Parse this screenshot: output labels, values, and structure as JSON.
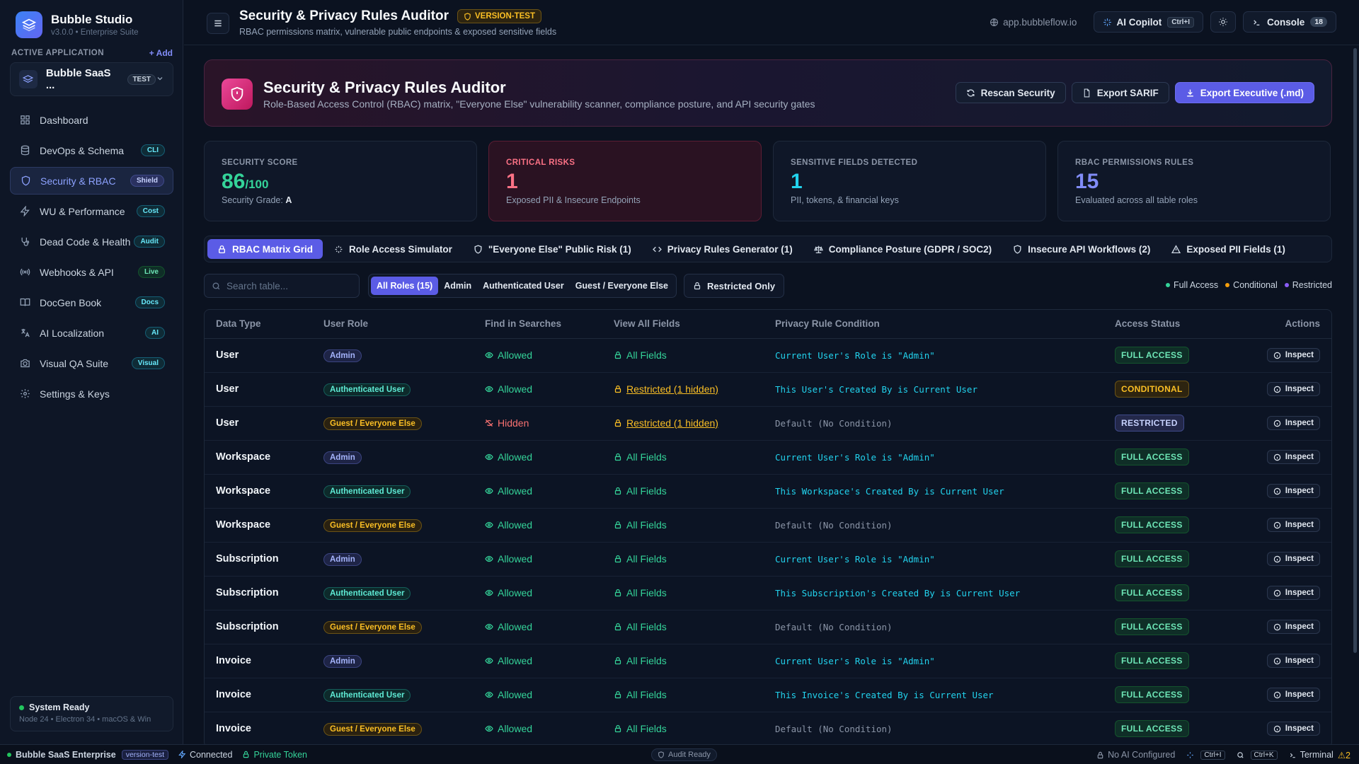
{
  "colors": {
    "accent": "#5b5ce6",
    "full_access": "#34d399",
    "conditional": "#f59e0b",
    "restricted": "#8b5cf6",
    "danger": "#fb7185"
  },
  "brand": {
    "name": "Bubble Studio",
    "version": "v3.0.0 • Enterprise Suite"
  },
  "sidebar": {
    "active_app_label": "ACTIVE APPLICATION",
    "add_label": "+ Add",
    "app_name": "Bubble SaaS ...",
    "app_tag": "TEST",
    "items": [
      {
        "label": "Dashboard",
        "icon": "grid-icon",
        "badge": ""
      },
      {
        "label": "DevOps & Schema",
        "icon": "database-icon",
        "badge": "CLI"
      },
      {
        "label": "Security & RBAC",
        "icon": "shield-icon",
        "badge": "Shield"
      },
      {
        "label": "WU & Performance",
        "icon": "bolt-icon",
        "badge": "Cost"
      },
      {
        "label": "Dead Code & Health",
        "icon": "stethoscope-icon",
        "badge": "Audit"
      },
      {
        "label": "Webhooks & API",
        "icon": "broadcast-icon",
        "badge": "Live"
      },
      {
        "label": "DocGen Book",
        "icon": "book-icon",
        "badge": "Docs"
      },
      {
        "label": "AI Localization",
        "icon": "translate-icon",
        "badge": "AI"
      },
      {
        "label": "Visual QA Suite",
        "icon": "camera-icon",
        "badge": "Visual"
      },
      {
        "label": "Settings & Keys",
        "icon": "gear-icon",
        "badge": ""
      }
    ],
    "status_title": "System Ready",
    "status_sub": "Node 24 • Electron 34 • macOS & Win"
  },
  "header": {
    "title": "Security & Privacy Rules Auditor",
    "version_badge": "VERSION-TEST",
    "subtitle": "RBAC permissions matrix, vulnerable public endpoints & exposed sensitive fields",
    "url": "app.bubbleflow.io",
    "copilot_label": "AI Copilot",
    "copilot_kbd": "Ctrl+I",
    "console_label": "Console",
    "console_count": "18"
  },
  "hero": {
    "title": "Security & Privacy Rules Auditor",
    "subtitle": "Role-Based Access Control (RBAC) matrix, \"Everyone Else\" vulnerability scanner, compliance posture, and API security gates",
    "rescan_label": "Rescan Security",
    "sarif_label": "Export SARIF",
    "exec_label": "Export Executive (.md)"
  },
  "stats": [
    {
      "label": "SECURITY SCORE",
      "value": "86",
      "suffix": "/100",
      "desc_prefix": "Security Grade: ",
      "desc_strong": "A"
    },
    {
      "label": "CRITICAL RISKS",
      "value": "1",
      "desc": "Exposed PII & Insecure Endpoints"
    },
    {
      "label": "SENSITIVE FIELDS DETECTED",
      "value": "1",
      "desc": "PII, tokens, & financial keys"
    },
    {
      "label": "RBAC PERMISSIONS RULES",
      "value": "15",
      "desc": "Evaluated across all table roles"
    }
  ],
  "tabs": [
    "RBAC Matrix Grid",
    "Role Access Simulator",
    "\"Everyone Else\" Public Risk (1)",
    "Privacy Rules Generator (1)",
    "Compliance Posture (GDPR / SOC2)",
    "Insecure API Workflows (2)",
    "Exposed PII Fields (1)"
  ],
  "filters": {
    "search_placeholder": "Search table...",
    "roles": [
      "All Roles (15)",
      "Admin",
      "Authenticated User",
      "Guest / Everyone Else"
    ],
    "restricted_only": "Restricted Only",
    "legend": [
      "Full Access",
      "Conditional",
      "Restricted"
    ]
  },
  "table": {
    "headers": [
      "Data Type",
      "User Role",
      "Find in Searches",
      "View All Fields",
      "Privacy Rule Condition",
      "Access Status",
      "Actions"
    ],
    "action_label": "Inspect",
    "rows": [
      {
        "type": "User",
        "role": "Admin",
        "role_kind": "admin",
        "find": "Allowed",
        "find_ok": true,
        "fields": "All Fields",
        "fields_ok": true,
        "cond": "Current User's Role is \"Admin\"",
        "cond_kind": "has",
        "status": "FULL ACCESS",
        "status_kind": "full"
      },
      {
        "type": "User",
        "role": "Authenticated User",
        "role_kind": "auth",
        "find": "Allowed",
        "find_ok": true,
        "fields": "Restricted (1 hidden)",
        "fields_ok": false,
        "cond": "This User's Created By is Current User",
        "cond_kind": "has",
        "status": "CONDITIONAL",
        "status_kind": "cond"
      },
      {
        "type": "User",
        "role": "Guest / Everyone Else",
        "role_kind": "guest",
        "find": "Hidden",
        "find_ok": false,
        "fields": "Restricted (1 hidden)",
        "fields_ok": false,
        "cond": "Default (No Condition)",
        "cond_kind": "def",
        "status": "RESTRICTED",
        "status_kind": "restr"
      },
      {
        "type": "Workspace",
        "role": "Admin",
        "role_kind": "admin",
        "find": "Allowed",
        "find_ok": true,
        "fields": "All Fields",
        "fields_ok": true,
        "cond": "Current User's Role is \"Admin\"",
        "cond_kind": "has",
        "status": "FULL ACCESS",
        "status_kind": "full"
      },
      {
        "type": "Workspace",
        "role": "Authenticated User",
        "role_kind": "auth",
        "find": "Allowed",
        "find_ok": true,
        "fields": "All Fields",
        "fields_ok": true,
        "cond": "This Workspace's Created By is Current User",
        "cond_kind": "has",
        "status": "FULL ACCESS",
        "status_kind": "full"
      },
      {
        "type": "Workspace",
        "role": "Guest / Everyone Else",
        "role_kind": "guest",
        "find": "Allowed",
        "find_ok": true,
        "fields": "All Fields",
        "fields_ok": true,
        "cond": "Default (No Condition)",
        "cond_kind": "def",
        "status": "FULL ACCESS",
        "status_kind": "full"
      },
      {
        "type": "Subscription",
        "role": "Admin",
        "role_kind": "admin",
        "find": "Allowed",
        "find_ok": true,
        "fields": "All Fields",
        "fields_ok": true,
        "cond": "Current User's Role is \"Admin\"",
        "cond_kind": "has",
        "status": "FULL ACCESS",
        "status_kind": "full"
      },
      {
        "type": "Subscription",
        "role": "Authenticated User",
        "role_kind": "auth",
        "find": "Allowed",
        "find_ok": true,
        "fields": "All Fields",
        "fields_ok": true,
        "cond": "This Subscription's Created By is Current User",
        "cond_kind": "has",
        "status": "FULL ACCESS",
        "status_kind": "full"
      },
      {
        "type": "Subscription",
        "role": "Guest / Everyone Else",
        "role_kind": "guest",
        "find": "Allowed",
        "find_ok": true,
        "fields": "All Fields",
        "fields_ok": true,
        "cond": "Default (No Condition)",
        "cond_kind": "def",
        "status": "FULL ACCESS",
        "status_kind": "full"
      },
      {
        "type": "Invoice",
        "role": "Admin",
        "role_kind": "admin",
        "find": "Allowed",
        "find_ok": true,
        "fields": "All Fields",
        "fields_ok": true,
        "cond": "Current User's Role is \"Admin\"",
        "cond_kind": "has",
        "status": "FULL ACCESS",
        "status_kind": "full"
      },
      {
        "type": "Invoice",
        "role": "Authenticated User",
        "role_kind": "auth",
        "find": "Allowed",
        "find_ok": true,
        "fields": "All Fields",
        "fields_ok": true,
        "cond": "This Invoice's Created By is Current User",
        "cond_kind": "has",
        "status": "FULL ACCESS",
        "status_kind": "full"
      },
      {
        "type": "Invoice",
        "role": "Guest / Everyone Else",
        "role_kind": "guest",
        "find": "Allowed",
        "find_ok": true,
        "fields": "All Fields",
        "fields_ok": true,
        "cond": "Default (No Condition)",
        "cond_kind": "def",
        "status": "FULL ACCESS",
        "status_kind": "full"
      }
    ]
  },
  "statusbar": {
    "app": "Bubble SaaS Enterprise",
    "branch": "version-test",
    "connected": "Connected",
    "token": "Private Token",
    "audit": "Audit Ready",
    "ai": "No AI Configured",
    "kbd1": "Ctrl+I",
    "kbd2": "Ctrl+K",
    "terminal": "Terminal",
    "warnings": "2"
  }
}
